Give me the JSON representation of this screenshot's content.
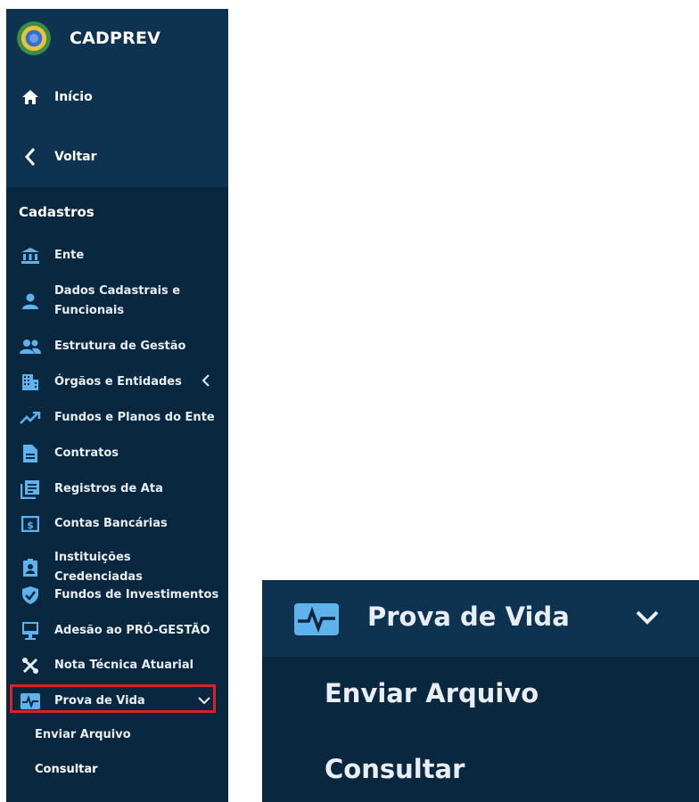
{
  "app": {
    "title": "CADPREV"
  },
  "top_nav": [
    {
      "label": "Início",
      "icon": "home-icon"
    },
    {
      "label": "Voltar",
      "icon": "chevron-left-icon"
    }
  ],
  "section": {
    "title": "Cadastros"
  },
  "menu": [
    {
      "label": "Ente",
      "icon": "bank-icon"
    },
    {
      "label": "Dados Cadastrais e",
      "label2": "Funcionais",
      "icon": "person-icon"
    },
    {
      "label": "Estrutura de Gestão",
      "icon": "group-icon"
    },
    {
      "label": "Órgãos e Entidades",
      "icon": "building-icon"
    },
    {
      "label": "Fundos e Planos do Ente",
      "icon": "trending-up-icon"
    },
    {
      "label": "Contratos",
      "icon": "document-icon"
    },
    {
      "label": "Registros de Ata",
      "icon": "notes-icon"
    },
    {
      "label": "Contas Bancárias",
      "icon": "money-icon"
    },
    {
      "label": "Instituições Credenciadas",
      "icon": "badge-icon"
    },
    {
      "label": "Fundos de Investimentos",
      "icon": "shield-check-icon"
    },
    {
      "label": "Adesão ao PRÓ-GESTÃO",
      "icon": "monitor-icon"
    },
    {
      "label": "Nota Técnica Atuarial",
      "icon": "tools-icon"
    },
    {
      "label": "Prova de Vida",
      "icon": "heartbeat-icon"
    }
  ],
  "submenu": [
    {
      "label": "Enviar Arquivo"
    },
    {
      "label": "Consultar"
    }
  ],
  "zoom": {
    "title": "Prova de Vida",
    "sub1": "Enviar Arquivo",
    "sub2": "Consultar"
  },
  "colors": {
    "sidebar_bg": "#0a2740",
    "header_bg": "#0e3350",
    "icon_blue": "#5fb3ec",
    "highlight": "#e01e25"
  }
}
